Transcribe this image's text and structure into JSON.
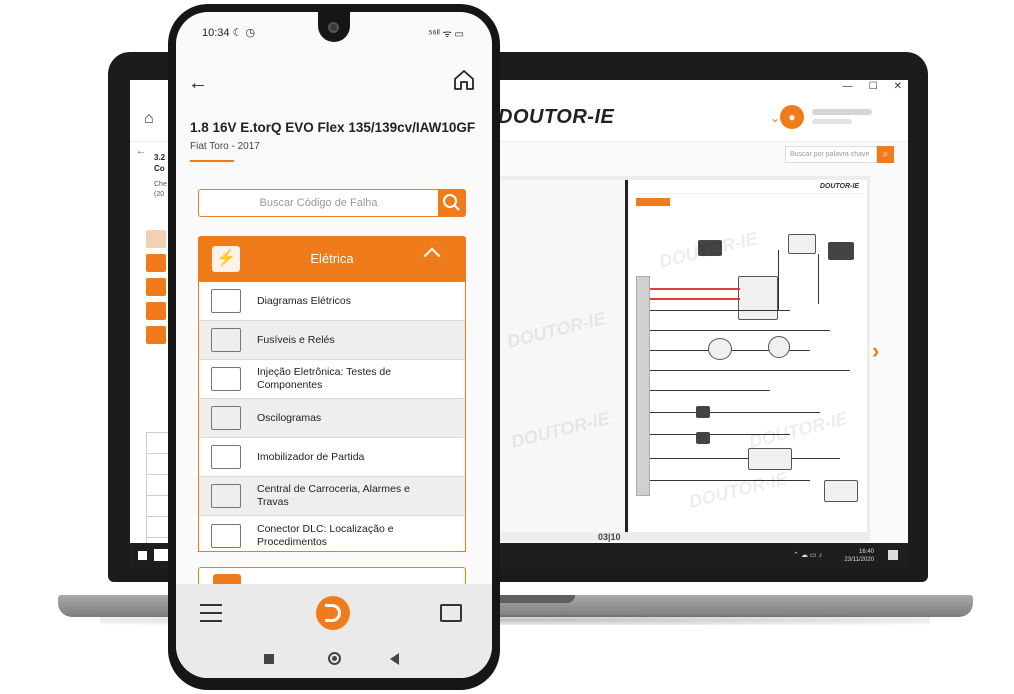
{
  "laptop": {
    "window_controls": [
      "—",
      "☐",
      "✕"
    ],
    "logo": "DOUTOR-IE",
    "search_placeholder": "Buscar por palavra chave",
    "left_code": "3.2\nCo",
    "left_sub": "Che\n(20",
    "page_number": "03|10",
    "page_logo": "DOUTOR-IE",
    "watermark": "DOUTOR-IE",
    "clock_time": "16:40",
    "clock_date": "23/11/2020"
  },
  "phone": {
    "status": {
      "time": "10:34",
      "icons": "⁵⁶ᴵˡ ᯤ ▭"
    },
    "title": "1.8 16V E.torQ EVO Flex 135/139cv/IAW10GF",
    "subtitle": "Fiat Toro - 2017",
    "search_placeholder": "Buscar Código de Falha",
    "category": {
      "label": "Elétrica",
      "icon": "lightning-icon"
    },
    "items": [
      {
        "label": "Diagramas Elétricos",
        "icon": "diagram-icon"
      },
      {
        "label": "Fusíveis e Relés",
        "icon": "fuse-icon"
      },
      {
        "label": "Injeção Eletrônica: Testes de Componentes",
        "icon": "multimeter-icon"
      },
      {
        "label": "Oscilogramas",
        "icon": "oscilloscope-icon"
      },
      {
        "label": "Imobilizador de Partida",
        "icon": "immobilizer-icon"
      },
      {
        "label": "Central de Carroceria, Alarmes e Travas",
        "icon": "car-key-icon"
      },
      {
        "label": "Conector DLC: Localização e Procedimentos",
        "icon": "dlc-connector-icon"
      }
    ]
  },
  "colors": {
    "accent": "#ef7b1a",
    "text": "#222222"
  }
}
